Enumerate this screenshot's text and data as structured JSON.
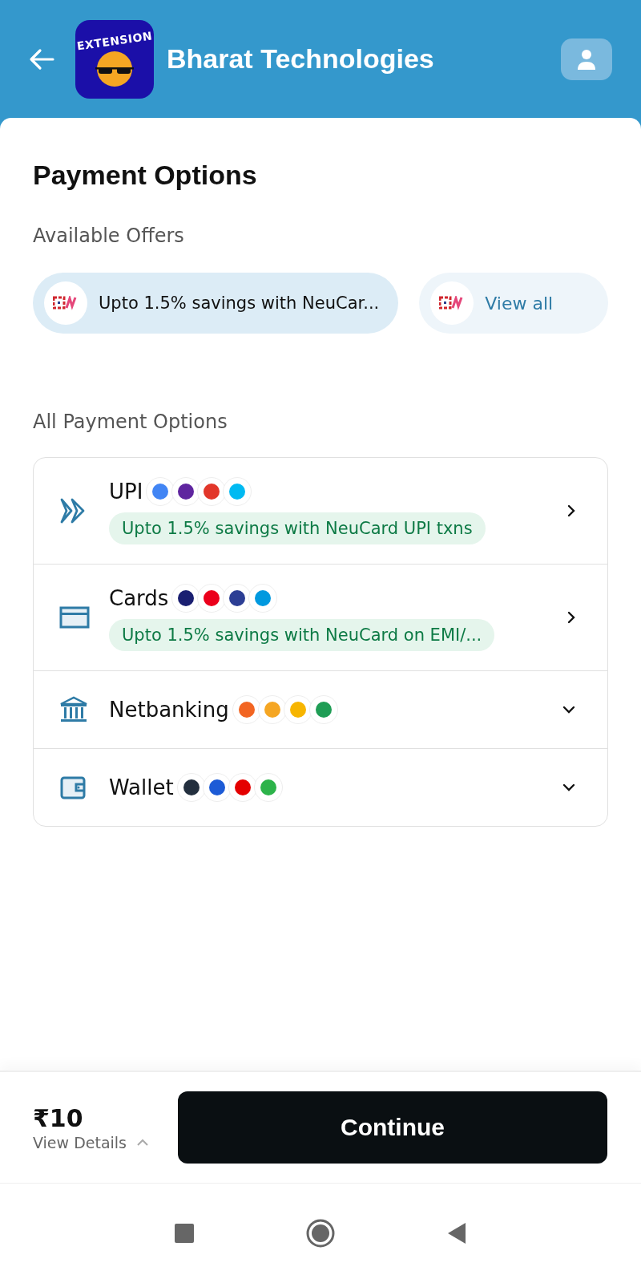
{
  "header": {
    "logo_text": "EXTENSION",
    "title": "Bharat Technologies"
  },
  "title": "Payment Options",
  "offers": {
    "heading": "Available Offers",
    "items": [
      {
        "kind": "offer",
        "text": "Upto 1.5% savings with NeuCar..."
      },
      {
        "kind": "link",
        "text": "View all"
      }
    ]
  },
  "methods": {
    "heading": "All Payment Options",
    "items": [
      {
        "kind": "upi",
        "name": "UPI",
        "expandable": false,
        "offer": "Upto 1.5% savings with NeuCard UPI txns",
        "logos": [
          {
            "color": "#4285f4"
          },
          {
            "color": "#5f259f"
          },
          {
            "color": "#e2372a"
          },
          {
            "color": "#00baf2"
          }
        ]
      },
      {
        "kind": "card",
        "name": "Cards",
        "expandable": false,
        "offer": "Upto 1.5% savings with NeuCard on EMI/...",
        "logos": [
          {
            "color": "#1a1f71"
          },
          {
            "color": "#eb001b"
          },
          {
            "color": "#2c3e94"
          },
          {
            "color": "#0099df"
          }
        ]
      },
      {
        "kind": "bank",
        "name": "Netbanking",
        "expandable": true,
        "logos": [
          {
            "color": "#f26522"
          },
          {
            "color": "#f5a623"
          },
          {
            "color": "#f7b500"
          },
          {
            "color": "#1f9d55"
          }
        ]
      },
      {
        "kind": "wallet",
        "name": "Wallet",
        "expandable": true,
        "logos": [
          {
            "color": "#232f3e"
          },
          {
            "color": "#1d5bd6"
          },
          {
            "color": "#e40000"
          },
          {
            "color": "#2db34a"
          }
        ]
      }
    ]
  },
  "footer": {
    "amount": "₹10",
    "details": "View Details",
    "button": "Continue"
  }
}
